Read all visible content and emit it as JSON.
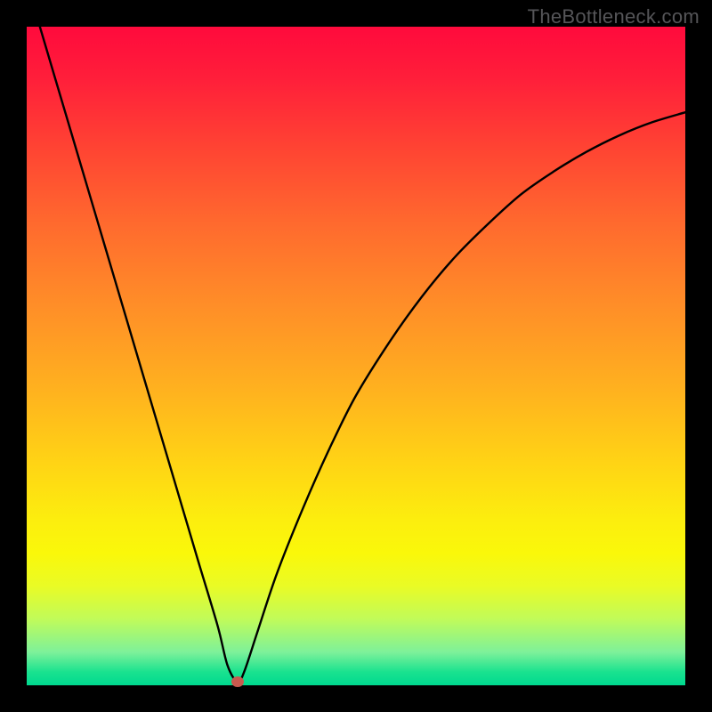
{
  "watermark": "TheBottleneck.com",
  "chart_data": {
    "type": "line",
    "title": "",
    "xlabel": "",
    "ylabel": "",
    "xlim": [
      0,
      100
    ],
    "ylim": [
      0,
      100
    ],
    "grid": false,
    "legend": false,
    "background_gradient": {
      "top": "#ff1238",
      "upper_mid": "#ff7a24",
      "mid": "#ffd315",
      "lower_mid": "#f7fb0c",
      "bottom": "#00d98f"
    },
    "series": [
      {
        "name": "bottleneck-curve",
        "color": "#000000",
        "x": [
          2,
          6,
          10,
          14,
          18,
          22,
          26,
          29,
          30.5,
          32,
          33,
          35,
          38,
          42,
          46,
          50,
          55,
          60,
          65,
          70,
          75,
          80,
          85,
          90,
          95,
          100
        ],
        "y": [
          100,
          86.5,
          73,
          59.5,
          46,
          32.5,
          19,
          9,
          3,
          0.5,
          2,
          8,
          17,
          27,
          36,
          44,
          52,
          59,
          65,
          70,
          74.5,
          78,
          81,
          83.5,
          85.5,
          87
        ]
      }
    ],
    "marker": {
      "name": "optimal-point",
      "x": 32,
      "y": 0.5,
      "color": "#c95a4f"
    }
  }
}
